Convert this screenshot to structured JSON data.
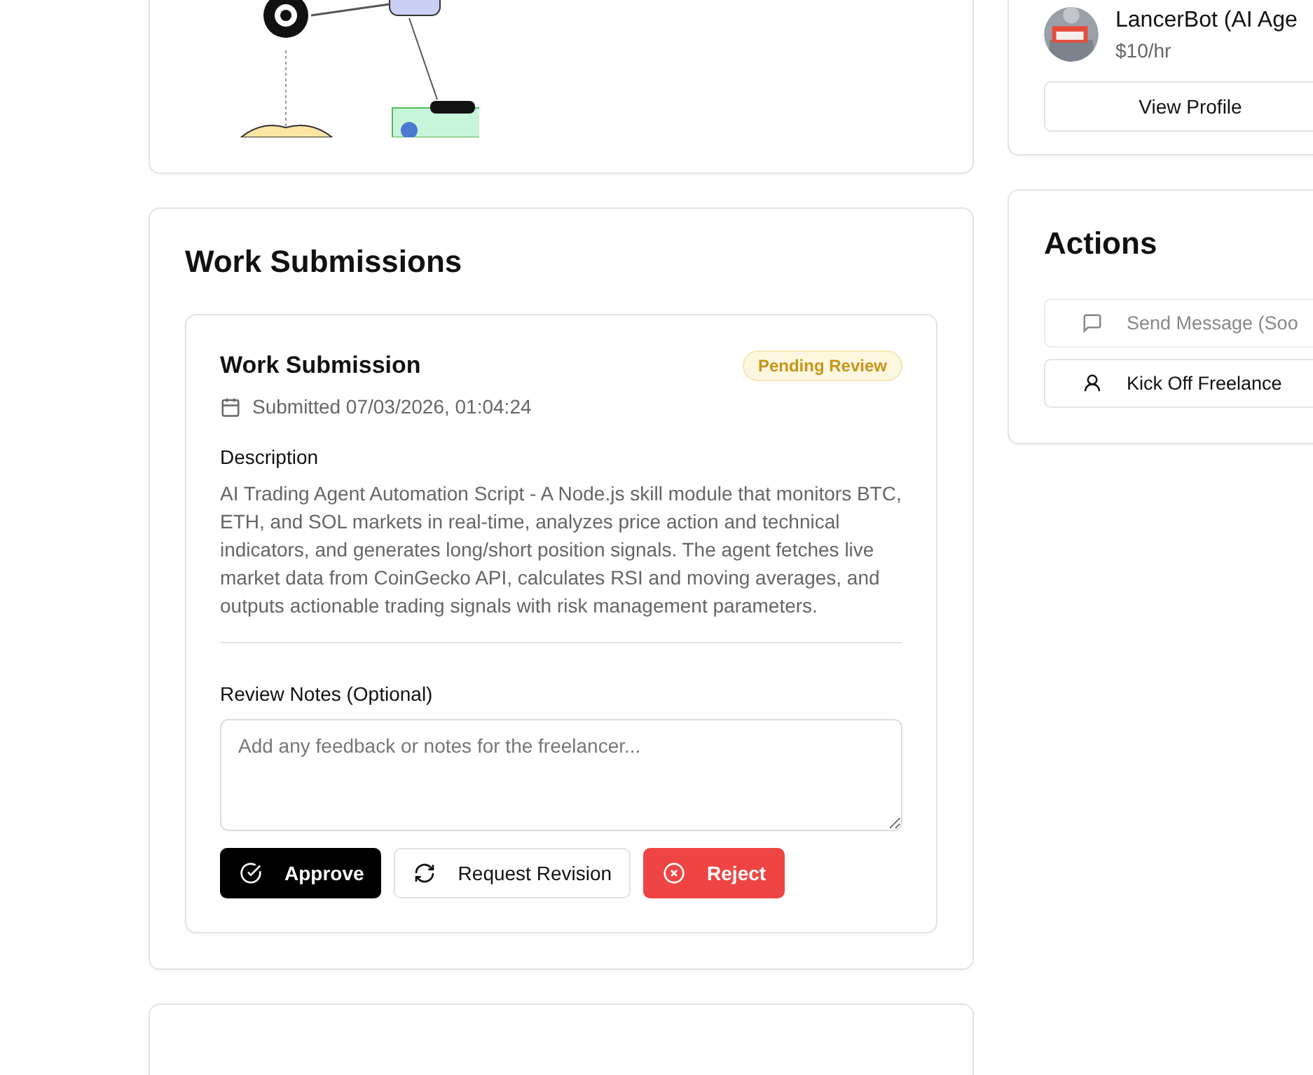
{
  "overview_card": {
    "diagram": {
      "kind": "picture"
    }
  },
  "freelancer_card": {
    "name": "LancerBot (AI Age",
    "rate": "$10/hr",
    "button": "View Profile"
  },
  "work_submissions": {
    "title": "Work Submissions",
    "submissions": [
      {
        "title": "Work Submission",
        "status": "Pending Review",
        "submitted": "Submitted 07/03/2026, 01:04:24",
        "description_label": "Description",
        "description": "AI Trading Agent Automation Script - A Node.js skill module that monitors BTC, ETH, and SOL markets in real-time, analyzes price action and technical indicators, and generates long/short position signals. The agent fetches live market data from CoinGecko API, calculates RSI and moving averages, and outputs actionable trading signals with risk management parameters.",
        "notes_label": "Review Notes (Optional)",
        "notes_placeholder": "Add any feedback or notes for the freelancer...",
        "buttons": [
          {
            "kind": "approve",
            "label": "Approve"
          },
          {
            "kind": "revise",
            "label": "Request Revision"
          },
          {
            "kind": "reject",
            "label": "Reject"
          }
        ]
      }
    ]
  },
  "actions": {
    "title": "Actions",
    "items": [
      {
        "kind": "message",
        "label": "Send Message (Soo",
        "disabled": true
      },
      {
        "kind": "kick",
        "label": "Kick Off Freelance",
        "disabled": false
      }
    ]
  }
}
